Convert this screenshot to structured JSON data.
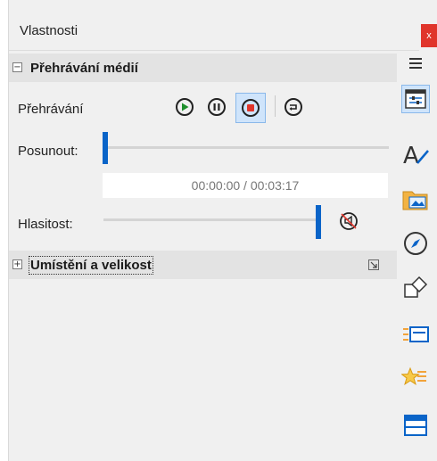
{
  "window": {
    "title": "Vlastnosti",
    "close_glyph": "x"
  },
  "media_section": {
    "title": "Přehrávání médií",
    "toggle_glyph": "−",
    "playback_label": "Přehrávání",
    "seek_label": "Posunout:",
    "time_text": "00:00:00 / 00:03:17",
    "volume_label": "Hlasitost:",
    "seek_position_fraction": 0.0,
    "volume_fraction": 1.0,
    "controls": [
      "play-icon",
      "pause-icon",
      "stop-icon",
      "loop-icon"
    ],
    "mute_icon": "mute-icon"
  },
  "position_section": {
    "title": "Umístění a velikost",
    "toggle_glyph": "+",
    "more_options_icon": "expand-dialog-icon"
  },
  "sidebar": {
    "menu_icon": "menu-icon",
    "items": [
      {
        "icon": "properties-icon",
        "active": true
      },
      {
        "icon": "styles-icon",
        "active": false
      },
      {
        "icon": "gallery-icon",
        "active": false
      },
      {
        "icon": "navigator-icon",
        "active": false
      },
      {
        "icon": "shapes-icon",
        "active": false
      },
      {
        "icon": "slide-transition-icon",
        "active": false
      },
      {
        "icon": "animation-icon",
        "active": false
      },
      {
        "icon": "master-slides-icon",
        "active": false
      }
    ]
  },
  "colors": {
    "accent": "#0a64c8",
    "close": "#e0352b",
    "play_green": "#1e8f2c",
    "stop_red": "#e0352b",
    "active_bg": "#cfe4fb"
  }
}
